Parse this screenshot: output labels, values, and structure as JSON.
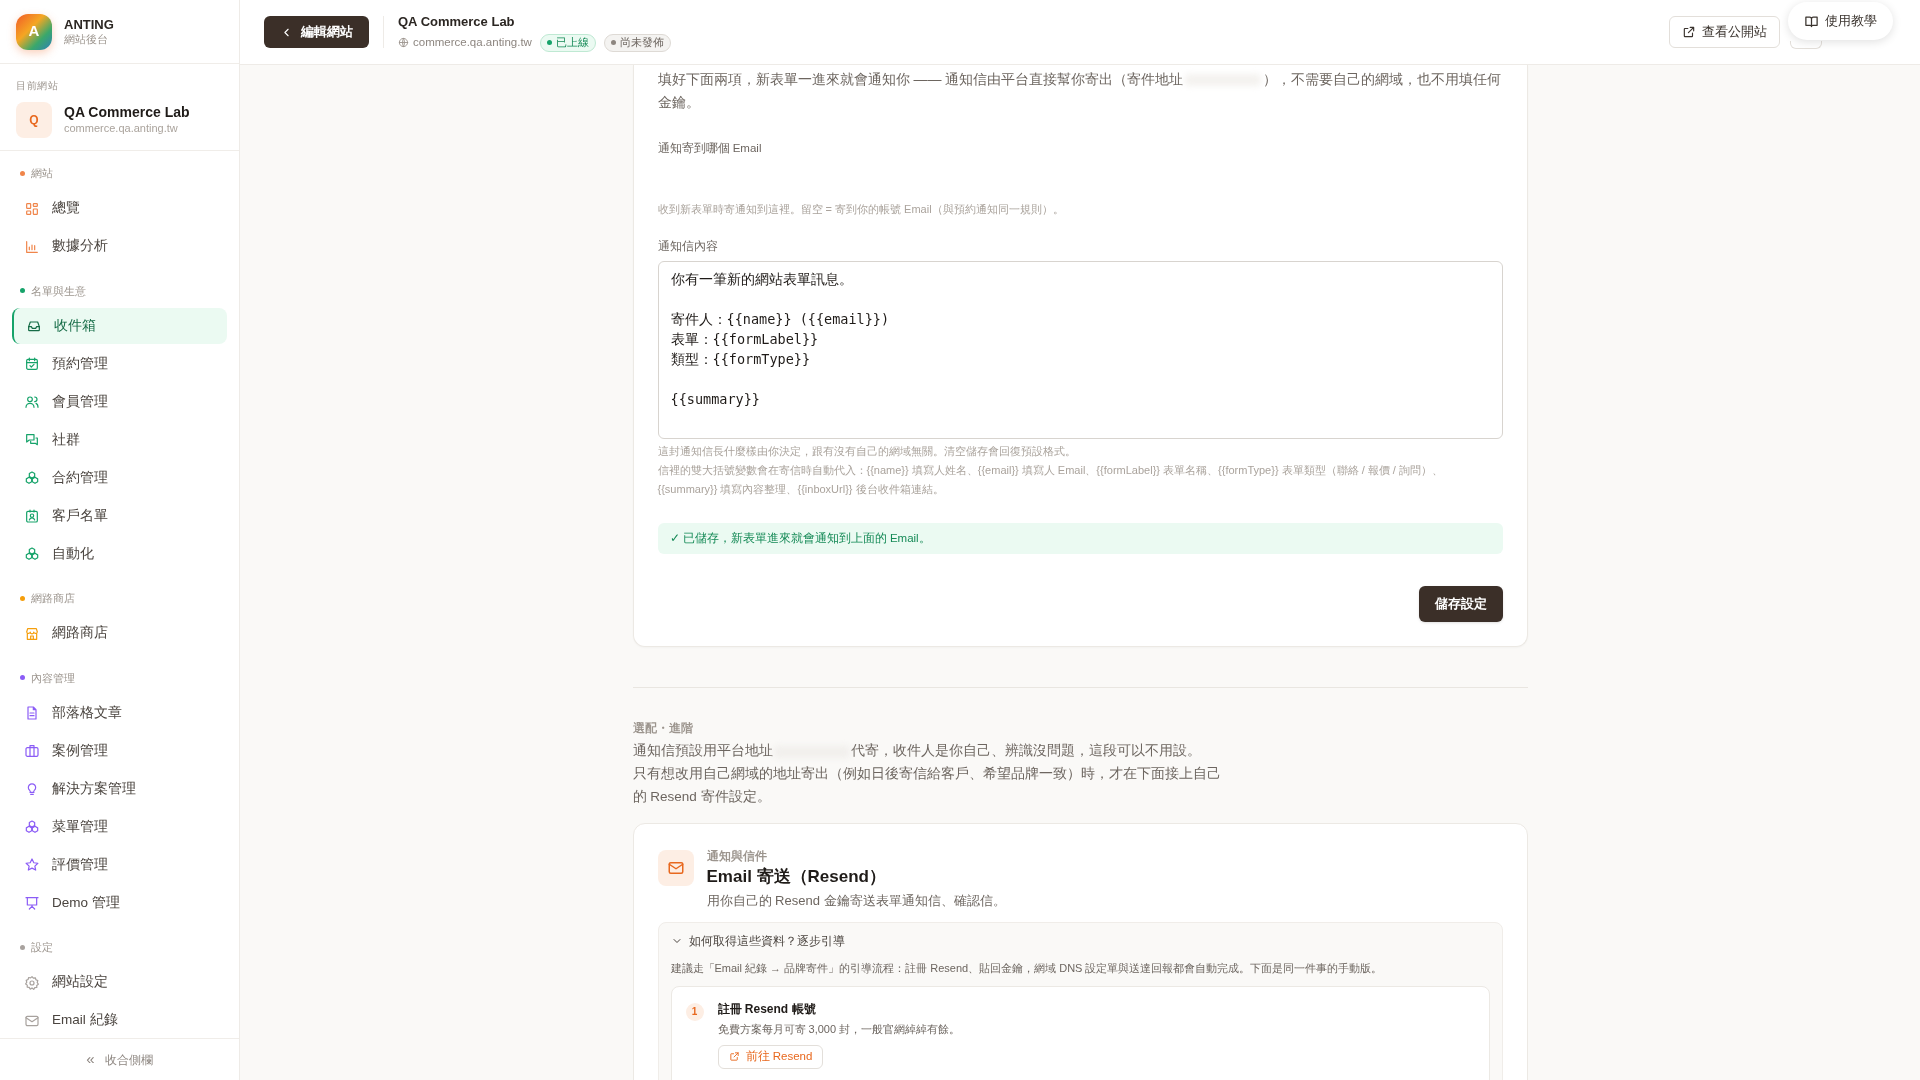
{
  "sidebar": {
    "brand": {
      "letter": "A",
      "name": "ANTING",
      "subtitle": "網站後台"
    },
    "site": {
      "label": "目前網站",
      "letter": "Q",
      "name": "QA Commerce Lab",
      "domain": "commerce.qa.anting.tw"
    },
    "sections": [
      {
        "label": "網站",
        "color": "#f0854a",
        "items": [
          {
            "label": "總覽",
            "selected": false
          },
          {
            "label": "數據分析",
            "selected": false
          }
        ]
      },
      {
        "label": "名單與生意",
        "color": "#16a36a",
        "items": [
          {
            "label": "收件箱",
            "selected": true
          },
          {
            "label": "預約管理",
            "selected": false
          },
          {
            "label": "會員管理",
            "selected": false
          },
          {
            "label": "社群",
            "selected": false
          },
          {
            "label": "合約管理",
            "selected": false
          },
          {
            "label": "客戶名單",
            "selected": false
          },
          {
            "label": "自動化",
            "selected": false
          }
        ]
      },
      {
        "label": "網路商店",
        "color": "#f59e0b",
        "items": [
          {
            "label": "網路商店",
            "selected": false
          }
        ]
      },
      {
        "label": "內容管理",
        "color": "#8b5cf6",
        "items": [
          {
            "label": "部落格文章",
            "selected": false
          },
          {
            "label": "案例管理",
            "selected": false
          },
          {
            "label": "解決方案管理",
            "selected": false
          },
          {
            "label": "菜單管理",
            "selected": false
          },
          {
            "label": "評價管理",
            "selected": false
          },
          {
            "label": "Demo 管理",
            "selected": false
          }
        ]
      },
      {
        "label": "設定",
        "color": "#a8a29e",
        "items": [
          {
            "label": "網站設定",
            "selected": false
          },
          {
            "label": "Email 紀錄",
            "selected": false
          }
        ]
      }
    ],
    "collapse": {
      "icon": "«",
      "label": "收合側欄"
    }
  },
  "header": {
    "back": "編輯網站",
    "title": "QA Commerce Lab",
    "domain": "commerce.qa.anting.tw",
    "badges": [
      {
        "label": "已上線",
        "kind": "live"
      },
      {
        "label": "尚未發佈",
        "kind": "draft"
      }
    ],
    "view_site": "查看公開站",
    "tutorial": "使用教學"
  },
  "notify_card": {
    "intro_before": "填好下面兩項，新表單一進來就會通知你 —— 通知信由平台直接幫你寄出（寄件地址",
    "intro_after": "），不需要自己的網域，也不用填任何金鑰。",
    "email_label": "通知寄到哪個 Email",
    "email_hint": "收到新表單時寄通知到這裡。留空 = 寄到你的帳號 Email（與預約通知同一規則）。",
    "body_label": "通知信內容",
    "body_blocks": [
      [
        "你有一筆新的網站表單訊息。"
      ],
      [
        "寄件人：{{name}} ({{email}})",
        "表單：{{formLabel}}",
        "類型：{{formType}}"
      ],
      [
        "{{summary}}"
      ]
    ],
    "notes": [
      "這封通知信長什麼樣由你決定，跟有沒有自己的網域無關。清空儲存會回復預設格式。",
      "信裡的雙大括號變數會在寄信時自動代入：{{name}} 填寫人姓名、{{email}} 填寫人 Email、{{formLabel}} 表單名稱、{{formType}} 表單類型（聯絡 / 報價 / 詢問）、{{summary}} 填寫內容整理、{{inboxUrl}} 後台收件箱連結。"
    ],
    "saved_message": "✓ 已儲存，新表單進來就會通知到上面的 Email。",
    "save": "儲存設定"
  },
  "advanced": {
    "label": "選配・進階",
    "text_before": "通知信預設用平台地址",
    "text_after": "代寄，收件人是你自己、辨識沒問題，這段可以不用設。",
    "text_more": "只有想改用自己網域的地址寄出（例如日後寄信給客戶、希望品牌一致）時，才在下面接上自己的 Resend 寄件設定。"
  },
  "resend_card": {
    "eyebrow": "通知與信件",
    "title": "Email 寄送（Resend）",
    "description": "用你自己的 Resend 金鑰寄送表單通知信、確認信。",
    "guide": {
      "expanded": true,
      "title": "如何取得這些資料？逐步引導",
      "text": "建議走「Email 紀錄 → 品牌寄件」的引導流程：註冊 Resend、貼回金鑰，網域 DNS 設定單與送達回報都會自動完成。下面是同一件事的手動版。",
      "steps": [
        {
          "number": "1",
          "title": "註冊 Resend 帳號",
          "text": "免費方案每月可寄 3,000 封，一般官網綽綽有餘。",
          "link": "前往 Resend"
        }
      ]
    }
  }
}
